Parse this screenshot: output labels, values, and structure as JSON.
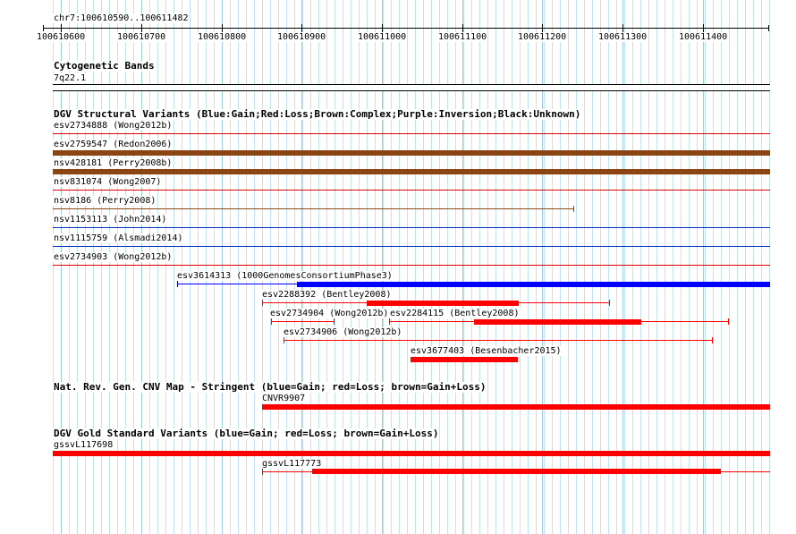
{
  "ruler": {
    "label": "chr7:100610590..100611482",
    "ticks": [
      "100610600",
      "100610700",
      "100610800",
      "100610900",
      "100611000",
      "100611100",
      "100611200",
      "100611300",
      "100611400"
    ]
  },
  "cytoband": {
    "title": "Cytogenetic Bands",
    "band": "7q22.1"
  },
  "dgv": {
    "title": "DGV Structural Variants (Blue:Gain;Red:Loss;Brown:Complex;Purple:Inversion;Black:Unknown)",
    "full_rows": [
      {
        "label": "esv2734888 (Wong2012b)",
        "color": "#e00000",
        "kind": "loss"
      },
      {
        "label": "esv2759547 (Redon2006)",
        "color": "#8b4513",
        "kind": "complex"
      },
      {
        "label": "nsv428181 (Perry2008b)",
        "color": "#8b4513",
        "kind": "complex"
      },
      {
        "label": "nsv831074 (Wong2007)",
        "color": "#e00000",
        "kind": "loss"
      },
      {
        "label": "nsv8186 (Perry2008)",
        "color": "#8b4513",
        "kind": "complex"
      },
      {
        "label": "nsv1153113 (John2014)",
        "color": "#0030c0",
        "kind": "gain"
      },
      {
        "label": "nsv1115759 (Alsmadi2014)",
        "color": "#0030c0",
        "kind": "gain"
      },
      {
        "label": "esv2734903 (Wong2012b)",
        "color": "#e00000",
        "kind": "loss"
      }
    ],
    "features": [
      {
        "label": "esv3614313 (1000GenomesConsortiumPhase3)",
        "color": "#0000ff"
      },
      {
        "label": "esv2288392 (Bentley2008)",
        "color": "#ff0000"
      },
      {
        "label": "esv2734904 (Wong2012b)",
        "color": "#ff0000"
      },
      {
        "label": "esv2284115 (Bentley2008)",
        "color": "#ff0000"
      },
      {
        "label": "esv2734906 (Wong2012b)",
        "color": "#ff0000"
      },
      {
        "label": "esv3677403 (Besenbacher2015)",
        "color": "#ff0000"
      }
    ]
  },
  "cnv": {
    "title": "Nat. Rev. Gen. CNV Map - Stringent (blue=Gain; red=Loss; brown=Gain+Loss)",
    "feature": "CNVR9907",
    "color": "#ff0000"
  },
  "gold": {
    "title": "DGV Gold Standard Variants (blue=Gain; red=Loss; brown=Gain+Loss)",
    "features": [
      {
        "label": "gssvL117698",
        "color": "#ff0000"
      },
      {
        "label": "gssvL117773",
        "color": "#ff0000"
      }
    ]
  }
}
